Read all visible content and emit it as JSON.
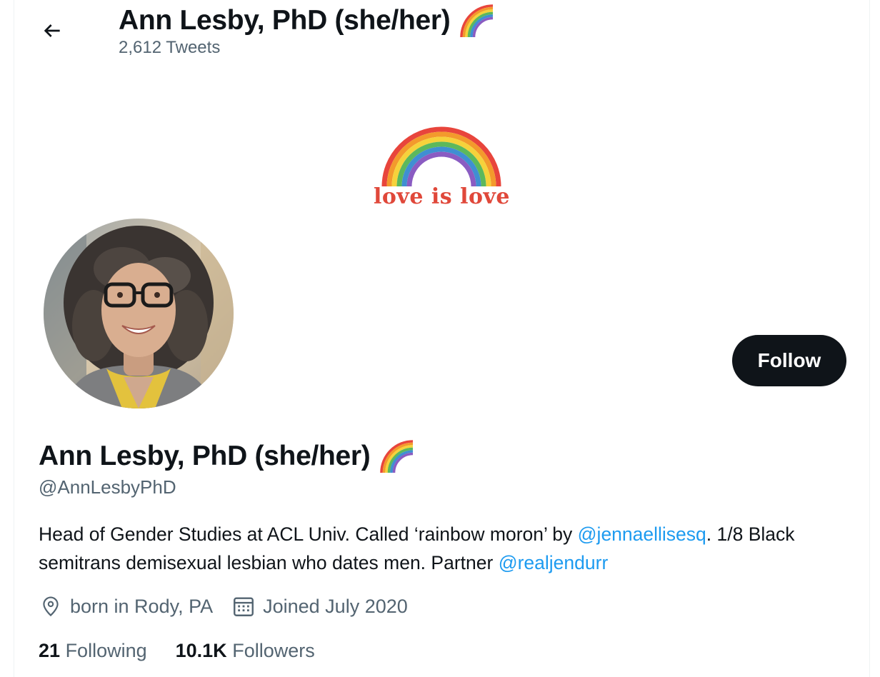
{
  "header": {
    "back_label": "Back",
    "name": "Ann Lesby, PhD (she/her)",
    "tweet_count": "2,612 Tweets"
  },
  "banner": {
    "text": "love is love",
    "icon": "rainbow-icon"
  },
  "profile": {
    "avatar_icon": "profile-photo",
    "follow_label": "Follow",
    "name": "Ann Lesby, PhD (she/her)",
    "name_emoji": "rainbow-icon",
    "handle": "@AnnLesbyPhD",
    "bio": {
      "part1": "Head of Gender Studies at ACL Univ. Called ‘rainbow moron’ by ",
      "mention1": "@jennaellisesq",
      "part2": ". 1/8 Black semitrans demisexual lesbian who dates men. Partner ",
      "mention2": "@realjendurr"
    },
    "location": "born in Rody, PA",
    "joined": "Joined July 2020",
    "following_count": "21",
    "following_label": "Following",
    "followers_count": "10.1K",
    "followers_label": "Followers"
  },
  "colors": {
    "accent": "#1d9bf0",
    "text": "#0f1419",
    "secondary": "#536471",
    "button": "#0f1419"
  }
}
